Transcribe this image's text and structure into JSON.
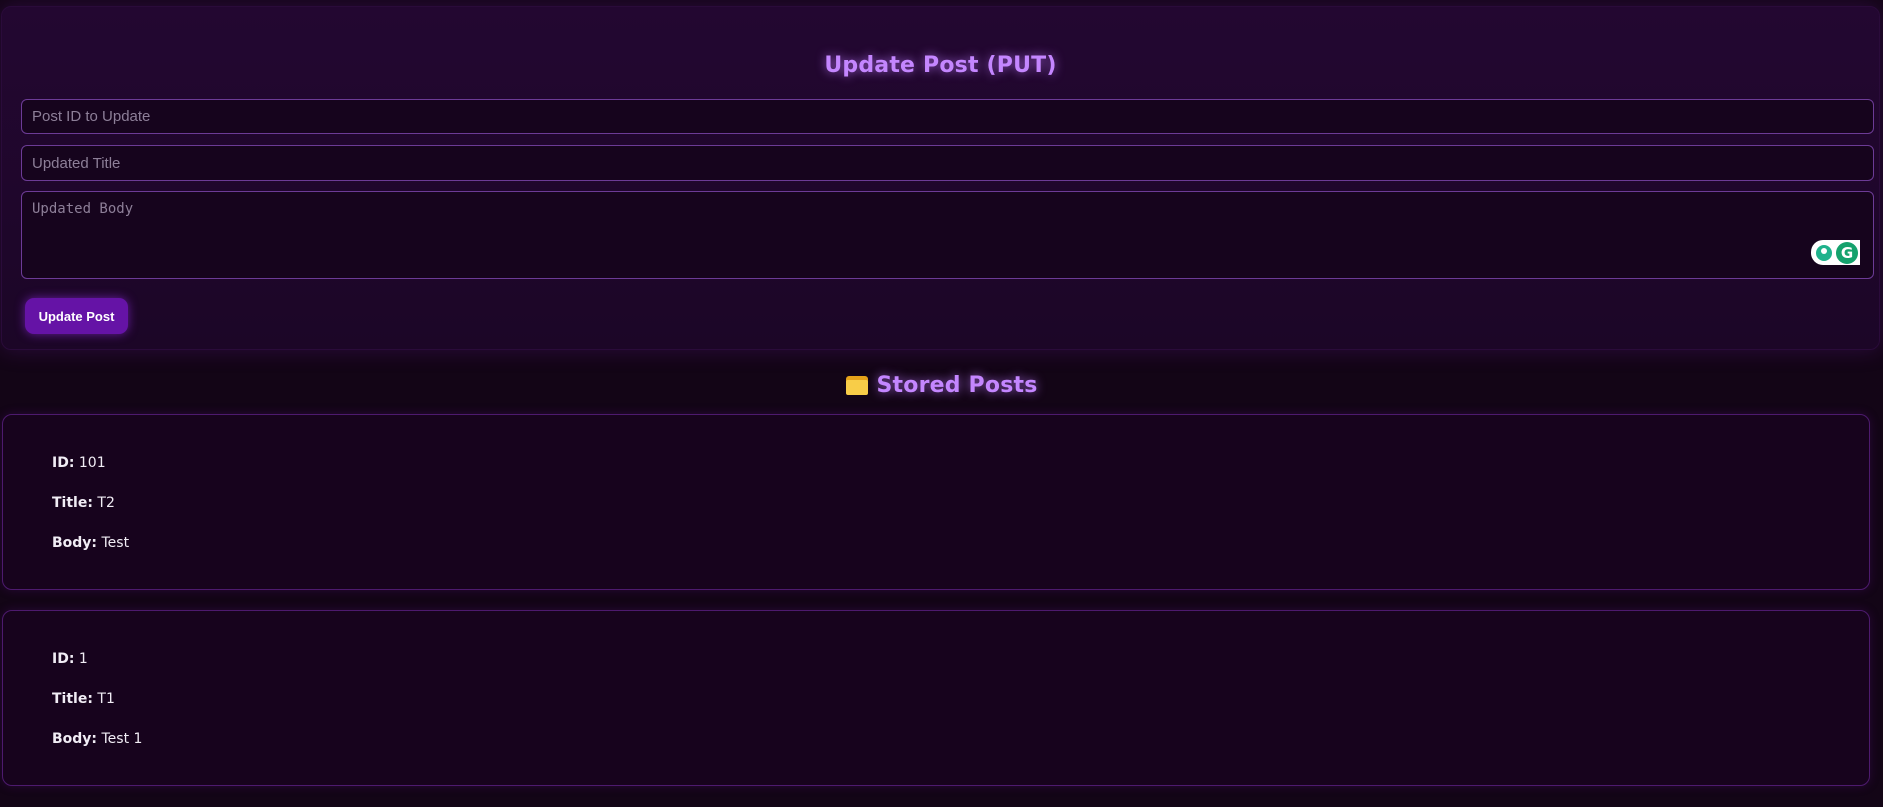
{
  "update_form": {
    "title": "Update Post (PUT)",
    "post_id_placeholder": "Post ID to Update",
    "title_placeholder": "Updated Title",
    "body_placeholder": "Updated Body",
    "submit_label": "Update Post",
    "accent_color": "#c486ff",
    "button_color": "#6513a6"
  },
  "stored_posts": {
    "heading": "Stored Posts",
    "heading_icon": "folder-icon",
    "labels": {
      "id": "ID:",
      "title": "Title:",
      "body": "Body:"
    },
    "posts": [
      {
        "id": "101",
        "title": "T2",
        "body": "Test"
      },
      {
        "id": "1",
        "title": "T1",
        "body": "Test 1"
      }
    ]
  },
  "grammar_widget": {
    "icons": [
      "lightbulb-icon",
      "grammar-g-icon"
    ],
    "g_letter": "G"
  }
}
